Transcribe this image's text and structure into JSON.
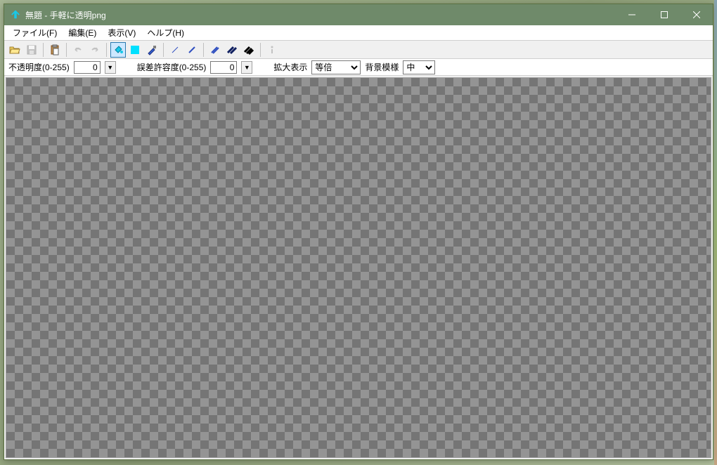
{
  "window": {
    "title": "無題 - 手軽に透明png"
  },
  "menu": {
    "file": "ファイル(F)",
    "edit": "編集(E)",
    "view": "表示(V)",
    "help": "ヘルプ(H)"
  },
  "toolbar": {
    "open": "open",
    "save": "save",
    "paste": "paste",
    "undo": "undo",
    "redo": "redo",
    "fill": "fill",
    "color": "color",
    "picker": "picker",
    "pen1": "pen-thin",
    "pen2": "pen-med",
    "pen3": "pen-thick",
    "pen4": "pen-double",
    "pen5": "pen-triple",
    "info": "info"
  },
  "options": {
    "opacity_label": "不透明度(0-255)",
    "opacity_value": "0",
    "tolerance_label": "誤差許容度(0-255)",
    "tolerance_value": "0",
    "zoom_label": "拡大表示",
    "zoom_value": "等倍",
    "bg_label": "背景模様",
    "bg_value": "中"
  }
}
